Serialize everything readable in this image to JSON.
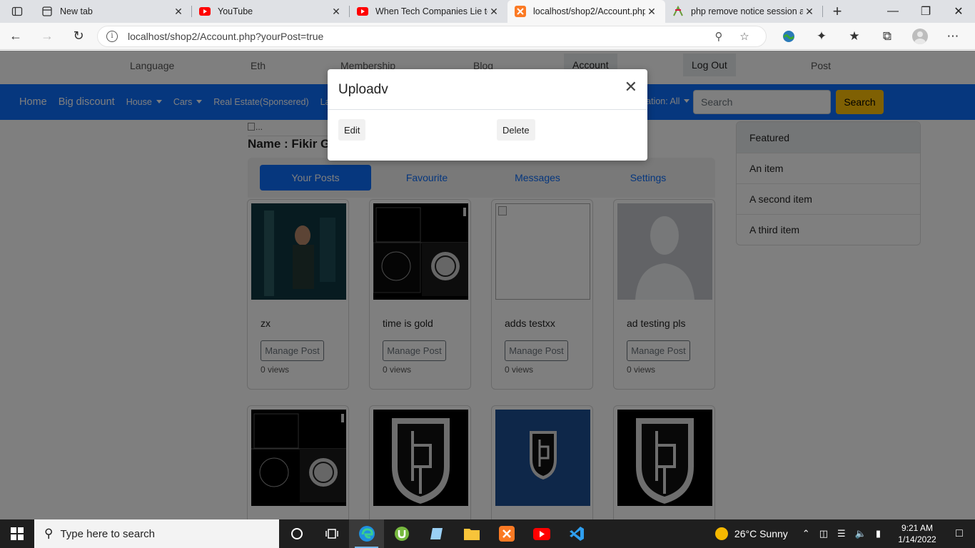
{
  "browser": {
    "tabs": [
      {
        "title": "New tab",
        "icon": "newtab-icon"
      },
      {
        "title": "YouTube",
        "icon": "youtube-icon"
      },
      {
        "title": "When Tech Companies Lie to",
        "icon": "youtube-icon"
      },
      {
        "title": "localhost/shop2/Account.php",
        "icon": "xampp-icon",
        "active": true
      },
      {
        "title": "php remove notice session al",
        "icon": "php-icon"
      }
    ],
    "url": "localhost/shop2/Account.php?yourPost=true"
  },
  "site": {
    "topnav": [
      "Language",
      "Eth",
      "Membership",
      "Blog",
      "Account",
      "Log Out",
      "Post"
    ],
    "mainnav": {
      "home": "Home",
      "big_discount": "Big discount",
      "house": "House",
      "cars": "Cars",
      "real_estate": "Real Estate(Sponsered)",
      "land": "Land",
      "location": "Location: All",
      "search_placeholder": "Search",
      "search_button": "Search"
    },
    "broken_image_alt": "...",
    "name_line": "Name : Fikir G",
    "profile_tabs": [
      "Your Posts",
      "Favourite",
      "Messages",
      "Settings"
    ],
    "cards_row1": [
      {
        "title": "zx",
        "button": "Manage Post",
        "views": "0 views"
      },
      {
        "title": "time is gold",
        "button": "Manage Post",
        "views": "0 views"
      },
      {
        "title": "adds testxx",
        "button": "Manage Post",
        "views": "0 views"
      },
      {
        "title": "ad testing pls",
        "button": "Manage Post",
        "views": "0 views"
      }
    ],
    "sidebar_list": [
      "Featured",
      "An item",
      "A second item",
      "A third item"
    ]
  },
  "modal": {
    "title": "Uploadv",
    "edit": "Edit",
    "delete": "Delete"
  },
  "taskbar": {
    "search_placeholder": "Type here to search",
    "weather": "26°C  Sunny",
    "time": "9:21 AM",
    "date": "1/14/2022"
  },
  "colors": {
    "primary": "#0d6efd",
    "warning": "#ffc107"
  }
}
